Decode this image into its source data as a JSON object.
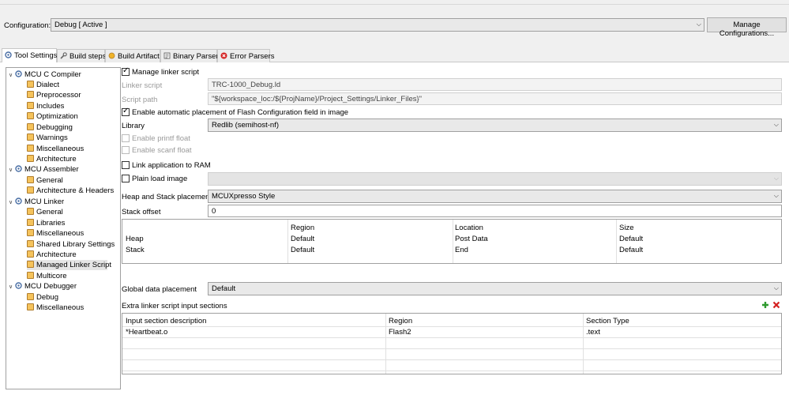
{
  "configuration": {
    "label": "Configuration:",
    "value": "Debug  [ Active ]",
    "manage_button": "Manage Configurations..."
  },
  "tabs": [
    {
      "label": "Tool Settings",
      "icon": "tool-settings-icon"
    },
    {
      "label": "Build steps",
      "icon": "wrench-icon"
    },
    {
      "label": "Build Artifact",
      "icon": "gear-artifact-icon"
    },
    {
      "label": "Binary Parsers",
      "icon": "binary-icon"
    },
    {
      "label": "Error Parsers",
      "icon": "error-icon"
    }
  ],
  "tree": {
    "groups": [
      {
        "label": "MCU C Compiler",
        "items": [
          "Dialect",
          "Preprocessor",
          "Includes",
          "Optimization",
          "Debugging",
          "Warnings",
          "Miscellaneous",
          "Architecture"
        ]
      },
      {
        "label": "MCU Assembler",
        "items": [
          "General",
          "Architecture & Headers"
        ]
      },
      {
        "label": "MCU Linker",
        "items": [
          "General",
          "Libraries",
          "Miscellaneous",
          "Shared Library Settings",
          "Architecture",
          "Managed Linker Script",
          "Multicore"
        ]
      },
      {
        "label": "MCU Debugger",
        "items": [
          "Debug",
          "Miscellaneous"
        ]
      }
    ],
    "selected": "Managed Linker Script"
  },
  "settings": {
    "manage_linker_script": "Manage linker script",
    "linker_script_label": "Linker script",
    "linker_script_value": "TRC-1000_Debug.ld",
    "script_path_label": "Script path",
    "script_path_value": "\"${workspace_loc:/${ProjName}/Project_Settings/Linker_Files}\"",
    "enable_auto_placement": "Enable automatic placement of Flash Configuration field in image",
    "library_label": "Library",
    "library_value": "Redlib (semihost-nf)",
    "enable_printf_float": "Enable printf float",
    "enable_scanf_float": "Enable scanf float",
    "link_to_ram": "Link application to RAM",
    "plain_load_image": "Plain load image",
    "heap_stack_label": "Heap and Stack placement",
    "heap_stack_value": "MCUXpresso Style",
    "stack_offset_label": "Stack offset",
    "stack_offset_value": "0",
    "global_data_label": "Global data placement",
    "global_data_value": "Default",
    "extra_sections_label": "Extra linker script input sections"
  },
  "heap_table": {
    "headers": [
      "",
      "Region",
      "Location",
      "Size"
    ],
    "rows": [
      [
        "Heap",
        "Default",
        "Post Data",
        "Default"
      ],
      [
        "Stack",
        "Default",
        "End",
        "Default"
      ]
    ]
  },
  "sections_table": {
    "headers": [
      "Input section description",
      "Region",
      "Section Type"
    ],
    "rows": [
      [
        "*Heartbeat.o",
        "Flash2",
        ".text"
      ]
    ]
  },
  "colors": {
    "add": "#2e9a2e",
    "remove": "#d42020",
    "selection": "#e5e5e5"
  }
}
